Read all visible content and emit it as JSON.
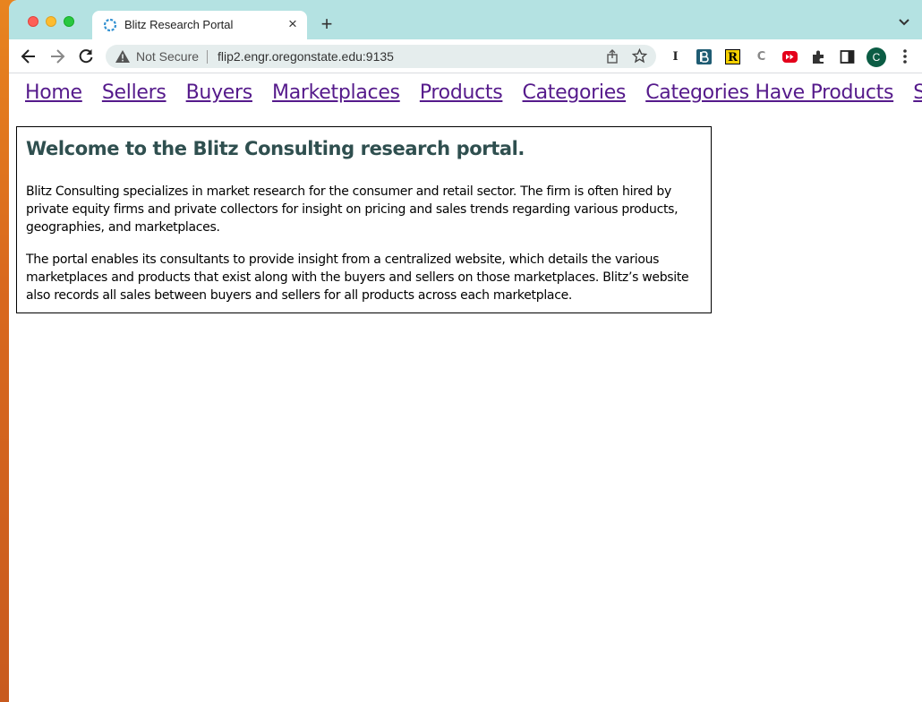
{
  "browser": {
    "tab_title": "Blitz Research Portal",
    "tab_close": "×",
    "new_tab": "+",
    "security_label": "Not Secure",
    "url": "flip2.engr.oregonstate.edu:9135",
    "profile_initial": "C",
    "extensions": [
      "I",
      "R",
      "C"
    ]
  },
  "nav": {
    "links": [
      "Home",
      "Sellers",
      "Buyers",
      "Marketplaces",
      "Products",
      "Categories",
      "Categories Have Products",
      "Sales"
    ]
  },
  "content": {
    "heading": "Welcome to the Blitz Consulting research portal.",
    "paragraph1": "Blitz Consulting specializes in market research for the consumer and retail sector. The firm is often hired by private equity firms and private collectors for insight on pricing and sales trends regarding various products, geographies, and marketplaces.",
    "paragraph2": "The portal enables its consultants to provide insight from a centralized website, which details the various marketplaces and products that exist along with the buyers and sellers on those marketplaces. Blitz’s website also records all sales between buyers and sellers for all products across each marketplace."
  },
  "colors": {
    "tabstrip": "#b4e2e2",
    "link_visited": "#551a8b",
    "heading": "#2f4f4f"
  }
}
